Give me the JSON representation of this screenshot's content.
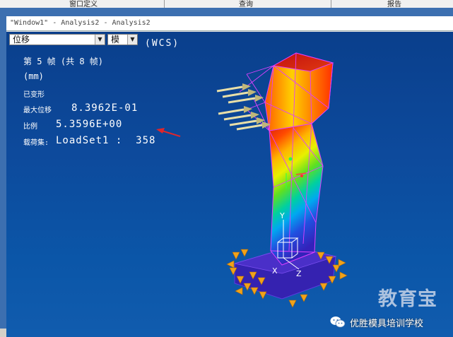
{
  "topbar": {
    "items": [
      "窗口定义",
      "查询",
      "报告"
    ]
  },
  "window": {
    "title": "\"Window1\" - Analysis2 - Analysis2"
  },
  "controls": {
    "quantity_select": "位移",
    "mode_select": "模",
    "coord_system": "(WCS)"
  },
  "info": {
    "frame": "第 5 帧 (共 8 帧)",
    "units": "(mm)",
    "deformed": "已变形",
    "max_disp_label": "最大位移",
    "max_disp_value": "8.3962E-01",
    "scale_label": "比例",
    "scale_value": "5.3596E+00",
    "loadset_label": "载荷集:",
    "loadset_value": "LoadSet1 :  358"
  },
  "axes": {
    "y": "Y",
    "x": "X",
    "z": "Z"
  },
  "watermark": {
    "brand": "教育宝",
    "account": "优胜模具培训学校"
  },
  "colors": {
    "accent_arrow": "#e0262b",
    "viewport_bg": "#0d4a9c",
    "load_arrow": "#e8dfa8",
    "constraint": "#f0a21a"
  }
}
